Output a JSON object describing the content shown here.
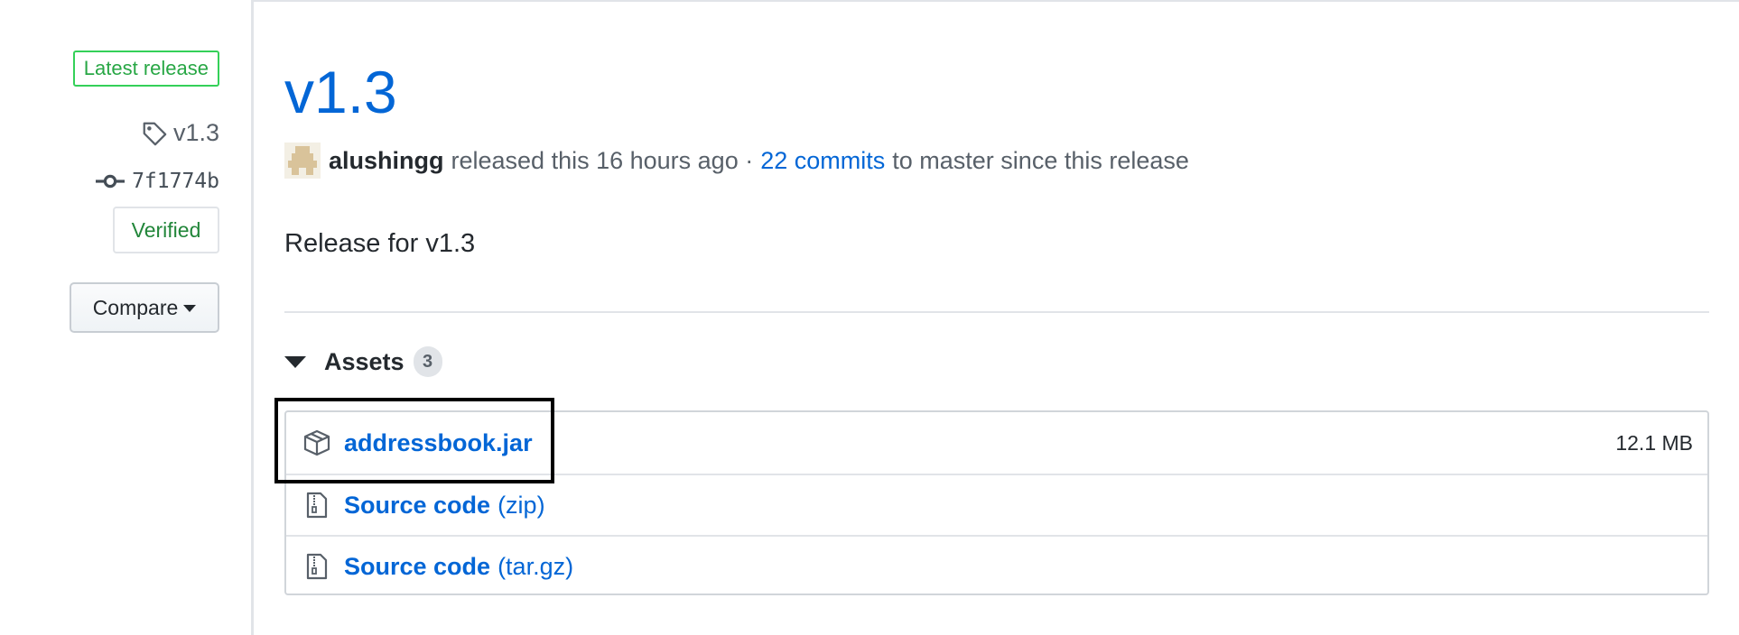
{
  "sidebar": {
    "latest_badge": "Latest release",
    "tag": "v1.3",
    "commit": "7f1774b",
    "verified": "Verified",
    "compare": "Compare"
  },
  "release": {
    "title": "v1.3",
    "author": "alushingg",
    "released_text": "released this 16 hours ago ·",
    "commits_link": "22 commits",
    "commits_suffix": "to master since this release",
    "description": "Release for v1.3"
  },
  "assets": {
    "heading": "Assets",
    "count": "3",
    "items": [
      {
        "name": "addressbook.jar",
        "suffix": "",
        "size": "12.1 MB",
        "icon": "package-icon"
      },
      {
        "name": "Source code",
        "suffix": "(zip)",
        "size": "",
        "icon": "file-zip-icon"
      },
      {
        "name": "Source code",
        "suffix": "(tar.gz)",
        "size": "",
        "icon": "file-zip-icon"
      }
    ]
  },
  "colors": {
    "link": "#0366d6",
    "latest_green": "#28a745",
    "verified_green": "#22863a",
    "highlight": "#000000"
  }
}
